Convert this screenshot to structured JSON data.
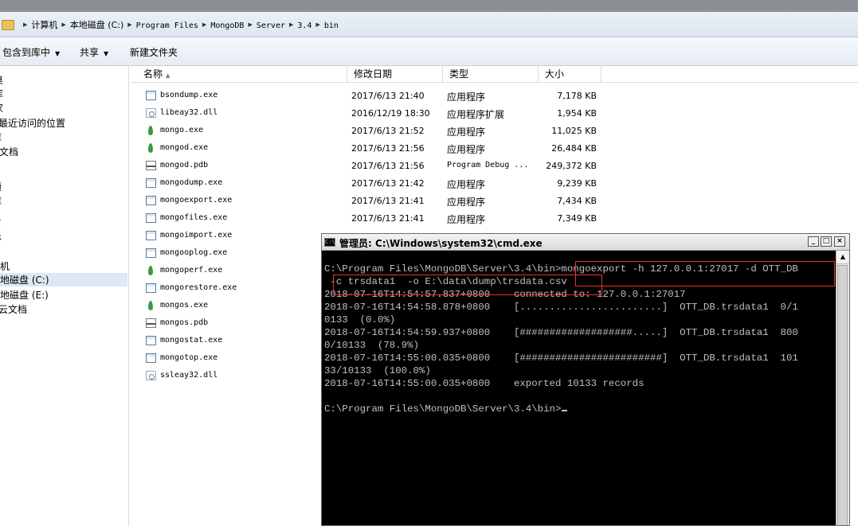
{
  "address_bar": {
    "crumbs": [
      "计算机",
      "本地磁盘 (C:)",
      "Program Files",
      "MongoDB",
      "Server",
      "3.4",
      "bin"
    ]
  },
  "toolbar": {
    "include_in_library": "包含到库中",
    "share": "共享",
    "new_folder": "新建文件夹"
  },
  "nav_pane": {
    "items": [
      "桌",
      "库",
      "家",
      "最近访问的位置",
      "库",
      "文档",
      "频",
      "库",
      "片",
      "乐",
      "算机",
      "本地磁盘 (C:)",
      "本地磁盘 (E:)",
      "云文档"
    ]
  },
  "file_list": {
    "columns": {
      "name": "名称",
      "date": "修改日期",
      "type": "类型",
      "size": "大小"
    },
    "files": [
      {
        "name": "bsondump.exe",
        "date": "2017/6/13 21:40",
        "type": "应用程序",
        "size": "7,178 KB",
        "icon": "exe-icon"
      },
      {
        "name": "libeay32.dll",
        "date": "2016/12/19 18:30",
        "type": "应用程序扩展",
        "size": "1,954 KB",
        "icon": "dll-icon"
      },
      {
        "name": "mongo.exe",
        "date": "2017/6/13 21:52",
        "type": "应用程序",
        "size": "11,025 KB",
        "icon": "mongodb-leaf-icon"
      },
      {
        "name": "mongod.exe",
        "date": "2017/6/13 21:56",
        "type": "应用程序",
        "size": "26,484 KB",
        "icon": "mongodb-leaf-icon"
      },
      {
        "name": "mongod.pdb",
        "date": "2017/6/13 21:56",
        "type": "Program Debug ...",
        "size": "249,372 KB",
        "icon": "pdb-icon"
      },
      {
        "name": "mongodump.exe",
        "date": "2017/6/13 21:42",
        "type": "应用程序",
        "size": "9,239 KB",
        "icon": "exe-icon"
      },
      {
        "name": "mongoexport.exe",
        "date": "2017/6/13 21:41",
        "type": "应用程序",
        "size": "7,434 KB",
        "icon": "exe-icon"
      },
      {
        "name": "mongofiles.exe",
        "date": "2017/6/13 21:41",
        "type": "应用程序",
        "size": "7,349 KB",
        "icon": "exe-icon"
      },
      {
        "name": "mongoimport.exe",
        "date": "",
        "type": "",
        "size": "",
        "icon": "exe-icon"
      },
      {
        "name": "mongooplog.exe",
        "date": "",
        "type": "",
        "size": "",
        "icon": "exe-icon"
      },
      {
        "name": "mongoperf.exe",
        "date": "",
        "type": "",
        "size": "",
        "icon": "mongodb-leaf-icon"
      },
      {
        "name": "mongorestore.exe",
        "date": "",
        "type": "",
        "size": "",
        "icon": "exe-icon"
      },
      {
        "name": "mongos.exe",
        "date": "",
        "type": "",
        "size": "",
        "icon": "mongodb-leaf-icon"
      },
      {
        "name": "mongos.pdb",
        "date": "",
        "type": "",
        "size": "",
        "icon": "pdb-icon"
      },
      {
        "name": "mongostat.exe",
        "date": "",
        "type": "",
        "size": "",
        "icon": "exe-icon"
      },
      {
        "name": "mongotop.exe",
        "date": "",
        "type": "",
        "size": "",
        "icon": "exe-icon"
      },
      {
        "name": "ssleay32.dll",
        "date": "",
        "type": "",
        "size": "",
        "icon": "dll-icon"
      }
    ]
  },
  "cmd_window": {
    "title": "管理员: C:\\Windows\\system32\\cmd.exe",
    "lines": [
      "C:\\Program Files\\MongoDB\\Server\\3.4\\bin>mongoexport -h 127.0.0.1:27017 -d OTT_DB",
      " -c trsdata1  -o E:\\data\\dump\\trsdata.csv",
      "2018-07-16T14:54:57.837+0800    connected to: 127.0.0.1:27017",
      "2018-07-16T14:54:58.878+0800    [........................]  OTT_DB.trsdata1  0/1",
      "0133  (0.0%)",
      "2018-07-16T14:54:59.937+0800    [###################.....]  OTT_DB.trsdata1  800",
      "0/10133  (78.9%)",
      "2018-07-16T14:55:00.035+0800    [########################]  OTT_DB.trsdata1  101",
      "33/10133  (100.0%)",
      "2018-07-16T14:55:00.035+0800    exported 10133 records",
      "",
      "C:\\Program Files\\MongoDB\\Server\\3.4\\bin>"
    ]
  },
  "colors": {
    "cmd_text": "#c0c0c0",
    "cmd_background": "#000000",
    "highlight_box": "#e8322f"
  }
}
